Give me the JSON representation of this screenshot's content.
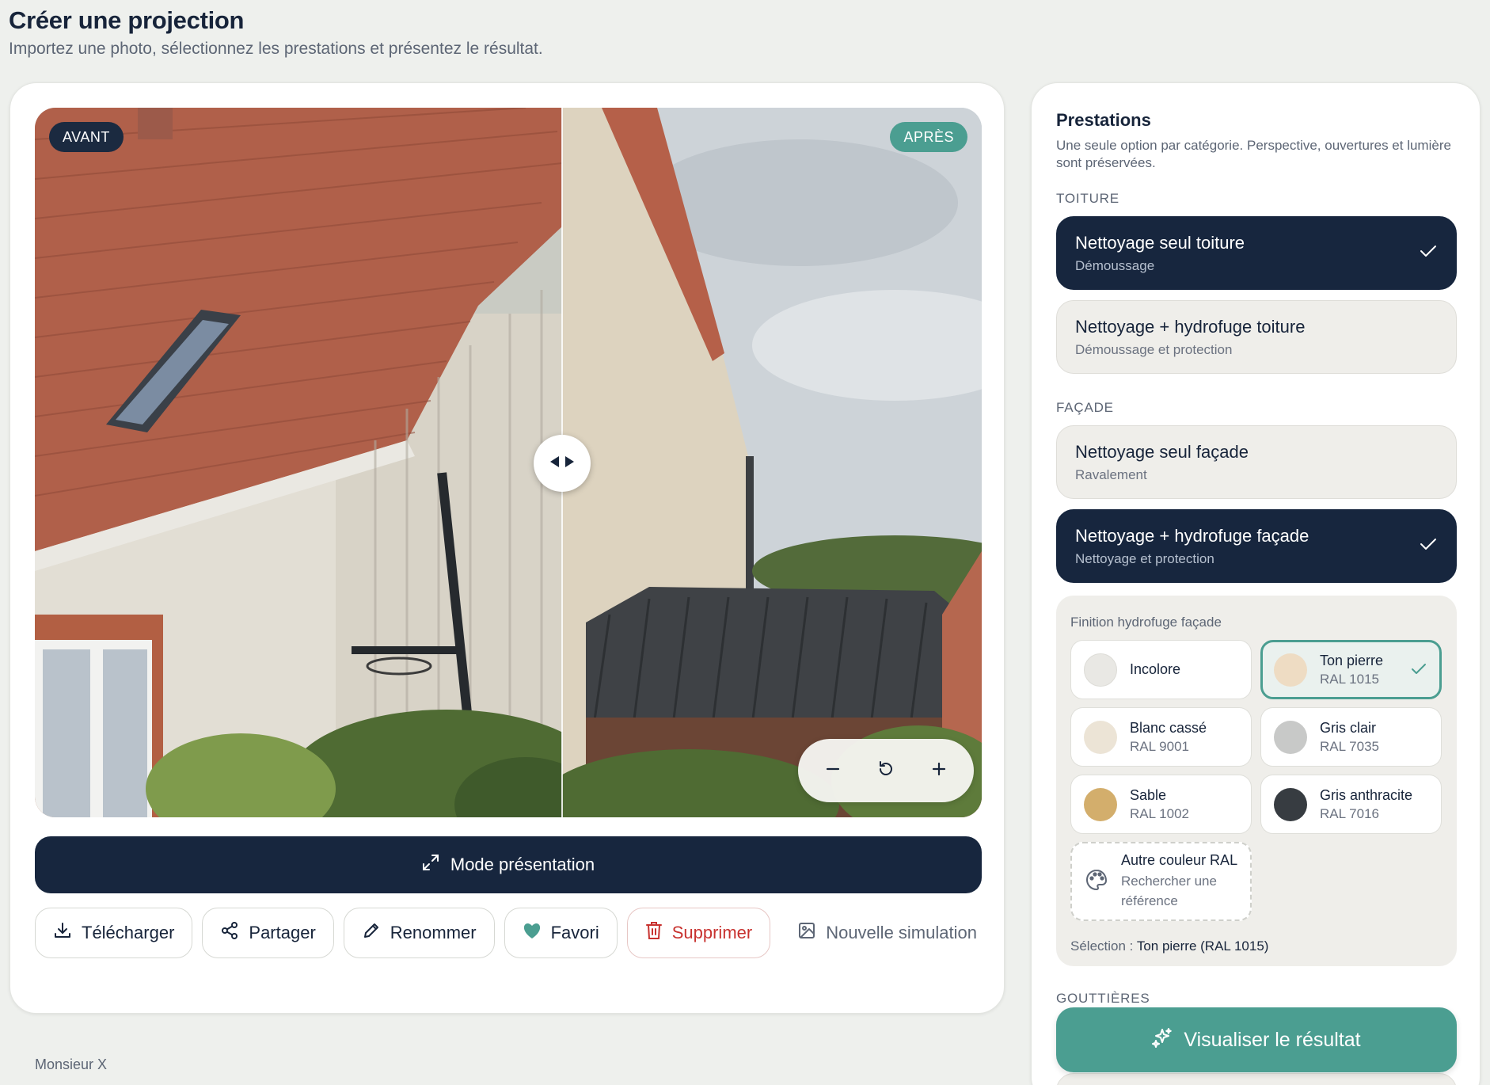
{
  "header": {
    "title": "Créer une projection",
    "subtitle": "Importez une photo, sélectionnez les prestations et présentez le résultat."
  },
  "viewer": {
    "before_label": "AVANT",
    "after_label": "APRÈS",
    "zoom_out_icon": "minus-icon",
    "reset_icon": "reset-icon",
    "zoom_in_icon": "plus-icon"
  },
  "presentation_button": "Mode présentation",
  "actions": {
    "download": "Télécharger",
    "share": "Partager",
    "rename": "Renommer",
    "favorite": "Favori",
    "delete": "Supprimer",
    "new_simulation": "Nouvelle simulation"
  },
  "client_name": "Monsieur X",
  "panel": {
    "title": "Prestations",
    "description": "Une seule option par catégorie. Perspective, ouvertures et lumière sont préservées.",
    "toiture": {
      "label": "TOITURE",
      "options": [
        {
          "title": "Nettoyage seul toiture",
          "sub": "Démoussage",
          "selected": true
        },
        {
          "title": "Nettoyage + hydrofuge toiture",
          "sub": "Démoussage et protection",
          "selected": false
        }
      ]
    },
    "facade": {
      "label": "FAÇADE",
      "options": [
        {
          "title": "Nettoyage seul façade",
          "sub": "Ravalement",
          "selected": false
        },
        {
          "title": "Nettoyage + hydrofuge façade",
          "sub": "Nettoyage et protection",
          "selected": true
        }
      ]
    },
    "finish": {
      "label": "Finition hydrofuge façade",
      "swatches": [
        {
          "name": "Incolore",
          "code": "",
          "color": "#e9e8e4"
        },
        {
          "name": "Ton pierre",
          "code": "RAL 1015",
          "color": "#eedcc3",
          "selected": true
        },
        {
          "name": "Blanc cassé",
          "code": "RAL 9001",
          "color": "#ece4d6"
        },
        {
          "name": "Gris clair",
          "code": "RAL 7035",
          "color": "#c8c9c8"
        },
        {
          "name": "Sable",
          "code": "RAL 1002",
          "color": "#d3ae6c"
        },
        {
          "name": "Gris anthracite",
          "code": "RAL 7016",
          "color": "#373c41"
        }
      ],
      "other": {
        "name": "Autre couleur RAL",
        "sub": "Rechercher une référence"
      },
      "selection_prefix": "Sélection :",
      "selection_value": "Ton pierre (RAL 1015)"
    },
    "gutters_label": "GOUTTIÈRES",
    "visualize_button": "Visualiser le résultat"
  },
  "colors": {
    "navy": "#17263e",
    "teal": "#4b9e91",
    "danger": "#c8322f"
  }
}
